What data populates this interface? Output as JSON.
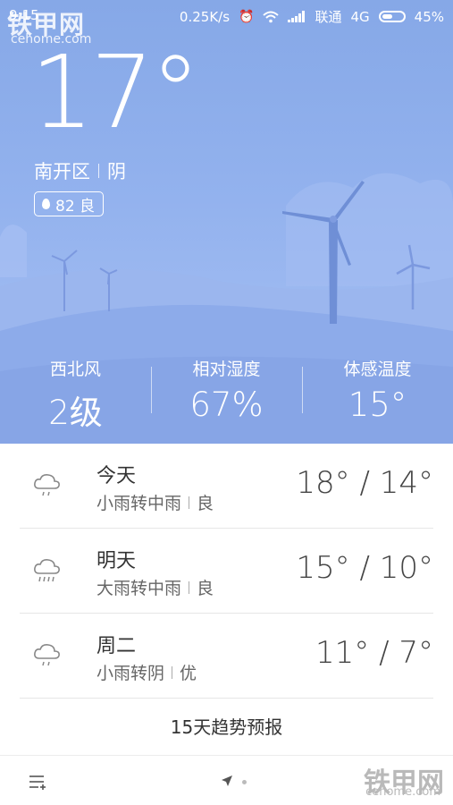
{
  "status_bar": {
    "time": "9:15",
    "net_speed": "0.25K/s",
    "carrier": "联通",
    "network_type": "4G",
    "battery": "45%",
    "icons": [
      "alarm-icon",
      "wifi-icon",
      "signal-icon",
      "battery-icon"
    ]
  },
  "watermark": {
    "brand": "铁甲网",
    "domain": "cehome.com"
  },
  "current": {
    "temperature": "17°",
    "district": "南开区",
    "condition": "阴",
    "aqi": "82 良"
  },
  "stats": [
    {
      "label": "西北风",
      "value": "2级"
    },
    {
      "label": "相对湿度",
      "value": "67%"
    },
    {
      "label": "体感温度",
      "value": "15°"
    }
  ],
  "forecast": [
    {
      "day": "今天",
      "desc": "小雨转中雨",
      "air": "良",
      "temps": "18° / 14°",
      "icon": "light-rain-icon"
    },
    {
      "day": "明天",
      "desc": "大雨转中雨",
      "air": "良",
      "temps": "15° / 10°",
      "icon": "heavy-rain-icon"
    },
    {
      "day": "周二",
      "desc": "小雨转阴",
      "air": "优",
      "temps": "11° / 7°",
      "icon": "light-rain-icon"
    }
  ],
  "trend_button": "15天趋势预报",
  "colors": {
    "sky_top": "#86a8e7",
    "sky_bottom": "#a9c2f3",
    "hill": "#7b9ce0",
    "turbine": "#6f8fd6"
  }
}
